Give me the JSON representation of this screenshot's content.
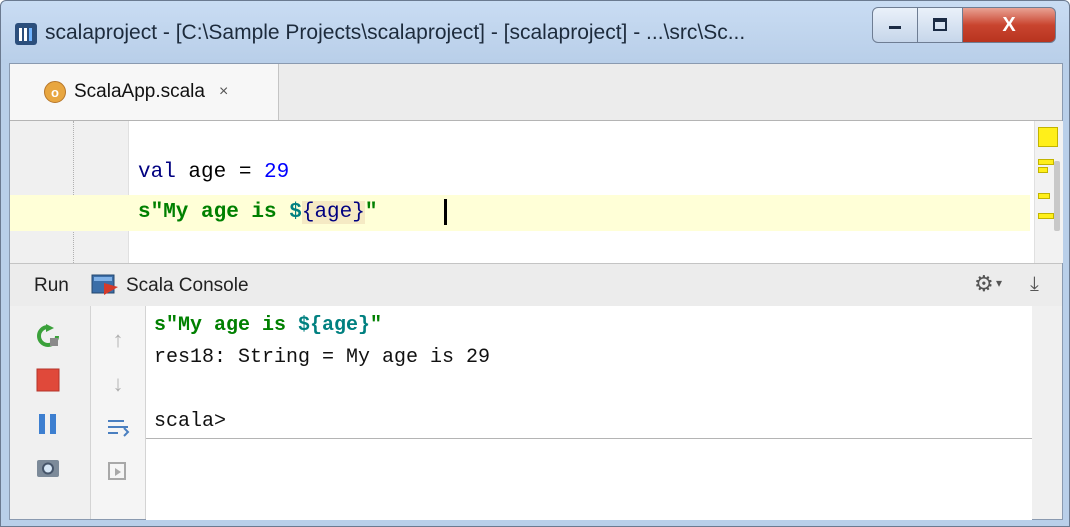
{
  "window": {
    "title": "scalaproject - [C:\\Sample Projects\\scalaproject] - [scalaproject] - ...\\src\\Sc...",
    "close_glyph": "X"
  },
  "tabs": [
    {
      "label": "ScalaApp.scala",
      "icon": "scala-object-icon",
      "close": "×"
    }
  ],
  "editor": {
    "line1": {
      "keyword": "val",
      "text": " age = ",
      "number": "29"
    },
    "line2": {
      "prefix": "s\"My age is ",
      "dollar": "$",
      "open": "{",
      "var": "age",
      "close": "}",
      "suffix": "\""
    }
  },
  "run_panel": {
    "run_label": "Run",
    "console_label": "Scala Console",
    "output": [
      "res18: String = My age is 29"
    ],
    "echo": {
      "prefix": "s\"My age is ",
      "interp": "${age}",
      "suffix": "\""
    },
    "prompt": "scala>"
  },
  "colors": {
    "keyword": "#000080",
    "number": "#0000ff",
    "string": "#008000",
    "interpolation": "#008080",
    "current_line": "#ffffd7",
    "marker": "#ffef1a"
  }
}
